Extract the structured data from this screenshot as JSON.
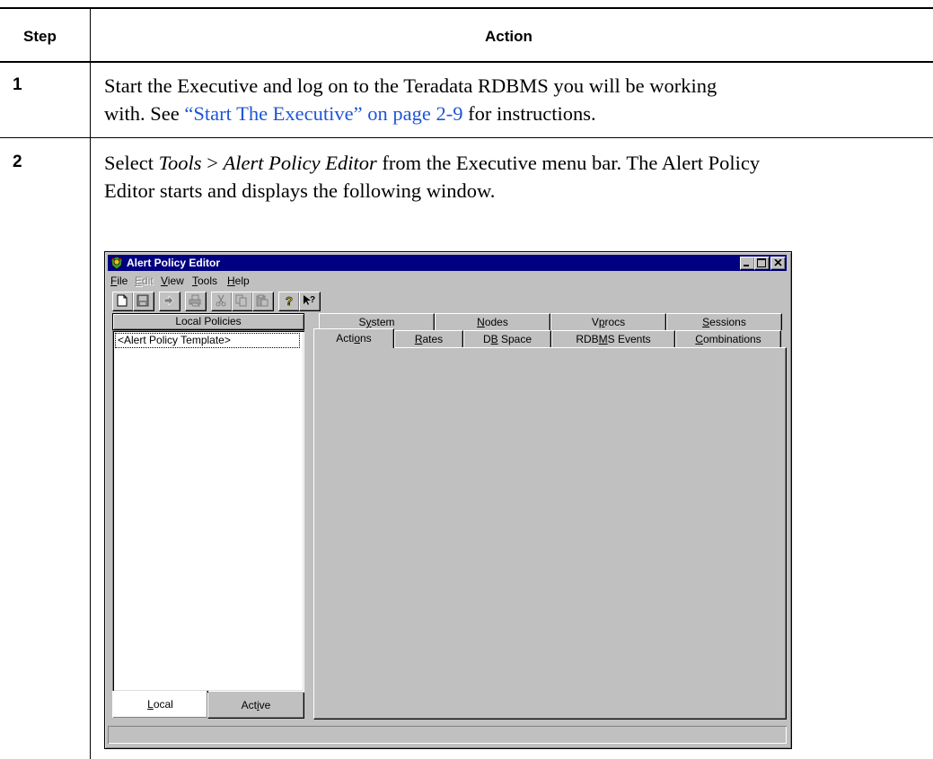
{
  "table": {
    "header_step": "Step",
    "header_action": "Action",
    "rows": [
      {
        "step": "1",
        "line1": "Start the Executive and log on to the Teradata RDBMS you will be working",
        "line2_prefix": "with. See ",
        "line2_link": "“Start The Executive” on page 2-9",
        "line2_suffix": " for instructions."
      },
      {
        "step": "2",
        "line1_a": "Select ",
        "line1_tools": "Tools",
        "line1_gt": " > ",
        "line1_editor": "Alert Policy Editor",
        "line1_b": " from the Executive menu bar. The Alert Policy",
        "line2": "Editor starts and displays the following window."
      }
    ]
  },
  "window": {
    "title": "Alert Policy Editor",
    "menu": [
      {
        "lead": "F",
        "rest": "ile",
        "enabled": true
      },
      {
        "lead": "E",
        "rest": "dit",
        "enabled": false
      },
      {
        "lead": "V",
        "rest": "iew",
        "enabled": true
      },
      {
        "lead": "T",
        "rest": "ools",
        "enabled": true
      },
      {
        "lead": "H",
        "rest": "elp",
        "enabled": true
      }
    ],
    "toolbar_icons": [
      "new-icon",
      "save-icon",
      "arrow-icon",
      "print-icon",
      "cut-icon",
      "copy-icon",
      "paste-icon",
      "help-icon",
      "context-help-icon"
    ],
    "left_panel": {
      "header": "Local Policies",
      "items": [
        "<Alert Policy Template>"
      ],
      "bottom_tabs": [
        {
          "lead": "L",
          "rest": "ocal",
          "selected": true
        },
        {
          "pre": "Act",
          "lead": "i",
          "rest": "ve",
          "selected": false
        }
      ]
    },
    "tabs_row1": [
      {
        "pre": "S",
        "lead": "y",
        "rest": "stem"
      },
      {
        "pre": "",
        "lead": "N",
        "rest": "odes"
      },
      {
        "pre": "V",
        "lead": "p",
        "rest": "rocs"
      },
      {
        "pre": "",
        "lead": "S",
        "rest": "essions"
      }
    ],
    "tabs_row2": [
      {
        "pre": "Acti",
        "lead": "o",
        "rest": "ns",
        "selected": true
      },
      {
        "pre": "",
        "lead": "R",
        "rest": "ates",
        "selected": false
      },
      {
        "pre": "D",
        "lead": "B",
        "rest": " Space",
        "selected": false
      },
      {
        "pre": "RDB",
        "lead": "M",
        "rest": "S Events",
        "selected": false
      },
      {
        "pre": "",
        "lead": "C",
        "rest": "ombinations",
        "selected": false
      }
    ],
    "colors": {
      "titlebar": "#000080",
      "face": "#c0c0c0",
      "link": "#1f55d6"
    }
  }
}
